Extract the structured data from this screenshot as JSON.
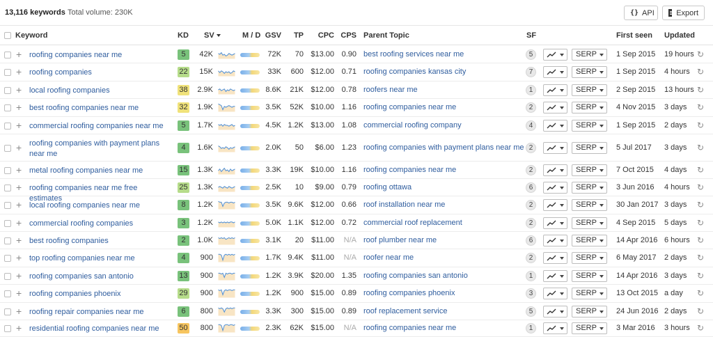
{
  "summary": {
    "keywords_count": "13,116 keywords",
    "total_volume": "Total volume: 230K"
  },
  "toolbar": {
    "api_icon": "{}",
    "api_label": "API",
    "export_label": "Export"
  },
  "columns": {
    "keyword": "Keyword",
    "kd": "KD",
    "sv": "SV",
    "md": "M / D",
    "gsv": "GSV",
    "tp": "TP",
    "cpc": "CPC",
    "cps": "CPS",
    "parent_topic": "Parent Topic",
    "sf": "SF",
    "first_seen": "First seen",
    "updated": "Updated"
  },
  "colors": {
    "kd_green": "#79c27b",
    "kd_light_green": "#b6dc8a",
    "kd_yellow": "#f0e27a",
    "kd_orange": "#f7c55f",
    "link": "#2f5d9e"
  },
  "rows": [
    {
      "keyword": "roofing companies near me",
      "kd": "5",
      "kd_color": "#79c27b",
      "sv": "42K",
      "gsv": "72K",
      "tp": "70",
      "cpc": "$13.00",
      "cps": "0.90",
      "parent_topic": "best roofing services near me",
      "sf": "5",
      "serp": "SERP",
      "first_seen": "1 Sep 2015",
      "updated": "19 hours",
      "spark": [
        6,
        5,
        7,
        4,
        5,
        3,
        4,
        6,
        5,
        4,
        5,
        6
      ]
    },
    {
      "keyword": "roofing companies",
      "kd": "22",
      "kd_color": "#b6dc8a",
      "sv": "15K",
      "gsv": "33K",
      "tp": "600",
      "cpc": "$12.00",
      "cps": "0.71",
      "parent_topic": "roofing companies kansas city",
      "sf": "7",
      "serp": "SERP",
      "first_seen": "1 Sep 2015",
      "updated": "4 hours",
      "spark": [
        6,
        4,
        6,
        5,
        3,
        5,
        4,
        5,
        3,
        4,
        6,
        5
      ]
    },
    {
      "keyword": "local roofing companies",
      "kd": "38",
      "kd_color": "#f0e27a",
      "sv": "2.9K",
      "gsv": "8.6K",
      "tp": "21K",
      "cpc": "$12.00",
      "cps": "0.78",
      "parent_topic": "roofers near me",
      "sf": "1",
      "serp": "SERP",
      "first_seen": "2 Sep 2015",
      "updated": "13 hours",
      "spark": [
        5,
        6,
        4,
        5,
        6,
        3,
        5,
        4,
        6,
        5,
        4,
        5
      ]
    },
    {
      "keyword": "best roofing companies near me",
      "kd": "32",
      "kd_color": "#f0e27a",
      "sv": "1.9K",
      "gsv": "3.5K",
      "tp": "52K",
      "cpc": "$10.00",
      "cps": "1.16",
      "parent_topic": "roofing companies near me",
      "sf": "2",
      "serp": "SERP",
      "first_seen": "4 Nov 2015",
      "updated": "3 days",
      "spark": [
        9,
        8,
        7,
        2,
        6,
        5,
        6,
        7,
        6,
        5,
        6,
        6
      ]
    },
    {
      "keyword": "commercial roofing companies near me",
      "kd": "5",
      "kd_color": "#79c27b",
      "sv": "1.7K",
      "gsv": "4.5K",
      "tp": "1.2K",
      "cpc": "$13.00",
      "cps": "1.08",
      "parent_topic": "commercial roofing company",
      "sf": "4",
      "serp": "SERP",
      "first_seen": "1 Sep 2015",
      "updated": "2 days",
      "spark": [
        6,
        5,
        6,
        4,
        6,
        5,
        5,
        4,
        5,
        6,
        4,
        5
      ]
    },
    {
      "keyword": "roofing companies with payment plans near me",
      "kd": "4",
      "kd_color": "#79c27b",
      "sv": "1.6K",
      "gsv": "2.0K",
      "tp": "50",
      "cpc": "$6.00",
      "cps": "1.23",
      "parent_topic": "roofing companies with payment plans near me",
      "sf": "2",
      "serp": "SERP",
      "first_seen": "5 Jul 2017",
      "updated": "3 days",
      "spark": [
        7,
        6,
        4,
        5,
        4,
        6,
        5,
        3,
        5,
        4,
        5,
        6
      ]
    },
    {
      "keyword": "metal roofing companies near me",
      "kd": "15",
      "kd_color": "#79c27b",
      "sv": "1.3K",
      "gsv": "3.3K",
      "tp": "19K",
      "cpc": "$10.00",
      "cps": "1.16",
      "parent_topic": "roofing companies near me",
      "sf": "2",
      "serp": "SERP",
      "first_seen": "7 Oct 2015",
      "updated": "4 days",
      "spark": [
        4,
        6,
        3,
        5,
        7,
        4,
        5,
        3,
        6,
        4,
        5,
        6
      ]
    },
    {
      "keyword": "roofing companies near me free estimates",
      "kd": "25",
      "kd_color": "#b6dc8a",
      "sv": "1.3K",
      "gsv": "2.5K",
      "tp": "10",
      "cpc": "$9.00",
      "cps": "0.79",
      "parent_topic": "roofing ottawa",
      "sf": "6",
      "serp": "SERP",
      "first_seen": "3 Jun 2016",
      "updated": "4 hours",
      "spark": [
        5,
        6,
        5,
        4,
        6,
        5,
        4,
        6,
        5,
        4,
        5,
        6
      ]
    },
    {
      "keyword": "local roofing companies near me",
      "kd": "8",
      "kd_color": "#79c27b",
      "sv": "1.2K",
      "gsv": "3.5K",
      "tp": "9.6K",
      "cpc": "$12.00",
      "cps": "0.66",
      "parent_topic": "roof installation near me",
      "sf": "2",
      "serp": "SERP",
      "first_seen": "30 Jan 2017",
      "updated": "3 days",
      "spark": [
        9,
        8,
        8,
        3,
        7,
        8,
        8,
        7,
        8,
        8,
        7,
        8
      ]
    },
    {
      "keyword": "commercial roofing companies",
      "kd": "3",
      "kd_color": "#79c27b",
      "sv": "1.2K",
      "gsv": "5.0K",
      "tp": "1.1K",
      "cpc": "$12.00",
      "cps": "0.72",
      "parent_topic": "commercial roof replacement",
      "sf": "2",
      "serp": "SERP",
      "first_seen": "4 Sep 2015",
      "updated": "5 days",
      "spark": [
        6,
        5,
        6,
        5,
        6,
        5,
        6,
        5,
        6,
        6,
        5,
        6
      ]
    },
    {
      "keyword": "best roofing companies",
      "kd": "2",
      "kd_color": "#79c27b",
      "sv": "1.0K",
      "gsv": "3.1K",
      "tp": "20",
      "cpc": "$11.00",
      "cps": "N/A",
      "parent_topic": "roof plumber near me",
      "sf": "6",
      "serp": "SERP",
      "first_seen": "14 Apr 2016",
      "updated": "6 hours",
      "spark": [
        8,
        7,
        8,
        7,
        8,
        6,
        7,
        8,
        7,
        8,
        7,
        8
      ]
    },
    {
      "keyword": "top roofing companies near me",
      "kd": "4",
      "kd_color": "#79c27b",
      "sv": "900",
      "gsv": "1.7K",
      "tp": "9.4K",
      "cpc": "$11.00",
      "cps": "N/A",
      "parent_topic": "roofer near me",
      "sf": "2",
      "serp": "SERP",
      "first_seen": "6 May 2017",
      "updated": "2 days",
      "spark": [
        9,
        9,
        8,
        2,
        8,
        9,
        8,
        9,
        8,
        9,
        8,
        9
      ]
    },
    {
      "keyword": "roofing companies san antonio",
      "kd": "13",
      "kd_color": "#79c27b",
      "sv": "900",
      "gsv": "1.2K",
      "tp": "3.9K",
      "cpc": "$20.00",
      "cps": "1.35",
      "parent_topic": "roofing companies san antonio",
      "sf": "1",
      "serp": "SERP",
      "first_seen": "14 Apr 2016",
      "updated": "3 days",
      "spark": [
        8,
        8,
        7,
        8,
        3,
        8,
        7,
        8,
        8,
        7,
        8,
        8
      ]
    },
    {
      "keyword": "roofing companies phoenix",
      "kd": "29",
      "kd_color": "#b6dc8a",
      "sv": "900",
      "gsv": "1.2K",
      "tp": "900",
      "cpc": "$15.00",
      "cps": "0.89",
      "parent_topic": "roofing companies phoenix",
      "sf": "3",
      "serp": "SERP",
      "first_seen": "13 Oct 2015",
      "updated": "a day",
      "spark": [
        9,
        8,
        9,
        3,
        8,
        9,
        8,
        9,
        9,
        8,
        9,
        9
      ]
    },
    {
      "keyword": "roofing repair companies near me",
      "kd": "6",
      "kd_color": "#79c27b",
      "sv": "800",
      "gsv": "3.3K",
      "tp": "300",
      "cpc": "$15.00",
      "cps": "0.89",
      "parent_topic": "roof replacement service",
      "sf": "5",
      "serp": "SERP",
      "first_seen": "24 Jun 2016",
      "updated": "2 days",
      "spark": [
        9,
        8,
        9,
        8,
        4,
        8,
        9,
        8,
        9,
        8,
        9,
        9
      ]
    },
    {
      "keyword": "residential roofing companies near me",
      "kd": "50",
      "kd_color": "#f7c55f",
      "sv": "800",
      "gsv": "2.3K",
      "tp": "62K",
      "cpc": "$15.00",
      "cps": "N/A",
      "parent_topic": "roofing companies near me",
      "sf": "1",
      "serp": "SERP",
      "first_seen": "3 Mar 2016",
      "updated": "3 hours",
      "spark": [
        9,
        9,
        8,
        2,
        8,
        9,
        9,
        8,
        9,
        9,
        8,
        9
      ]
    }
  ]
}
